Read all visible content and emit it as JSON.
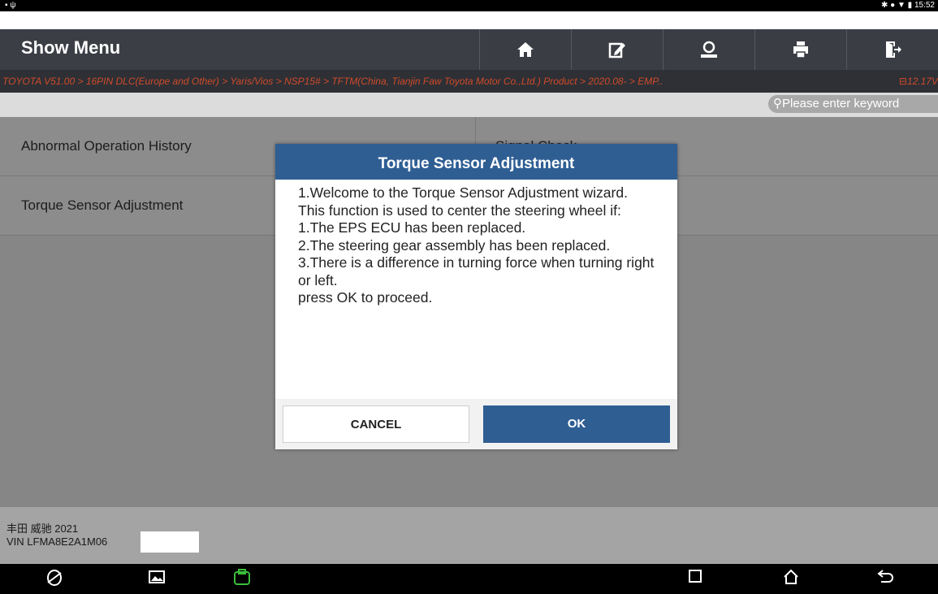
{
  "statusbar": {
    "left_icons": [
      "image-icon",
      "usb-icon"
    ],
    "right_icons": [
      "bluetooth-icon",
      "dnd-icon",
      "wifi-icon",
      "battery-icon"
    ],
    "time": "15:52"
  },
  "header": {
    "title": "Show Menu",
    "buttons": [
      "home-icon",
      "edit-icon",
      "user-icon",
      "print-icon",
      "exit-icon"
    ]
  },
  "breadcrumb": {
    "path": "TOYOTA V51.00 > 16PIN DLC(Europe and Other) > Yaris/Vios > NSP15# > TFTM(China, Tianjin Faw Toyota Motor Co.,Ltd.) Product > 2020.08- > EMP..",
    "voltage": "12.17V"
  },
  "search": {
    "placeholder": "Please enter keyword"
  },
  "menu": {
    "items": [
      {
        "label": "Abnormal Operation History",
        "right_label": "Signal Check"
      },
      {
        "label": "Torque Sensor Adjustment",
        "right_label": ""
      }
    ]
  },
  "footer": {
    "car": "丰田 威驰 2021",
    "vin": "VIN LFMA8E2A1M06"
  },
  "dialog": {
    "title": "Torque Sensor Adjustment",
    "lines": [
      "1.Welcome to the Torque Sensor Adjustment wizard.",
      "This function is used to center the steering wheel if:",
      "1.The EPS ECU has been replaced.",
      "2.The steering gear assembly has been replaced.",
      "3.There is a difference in turning force when turning right or left.",
      "press OK to proceed."
    ],
    "cancel_label": "CANCEL",
    "ok_label": "OK"
  },
  "navbar": {
    "icons": [
      "browser-icon",
      "gallery-icon",
      "vci-icon",
      "recent-apps-icon",
      "home-nav-icon",
      "back-icon"
    ]
  },
  "colors": {
    "accent": "#2f5e93",
    "breadcrumb_text": "#d04a2a"
  }
}
